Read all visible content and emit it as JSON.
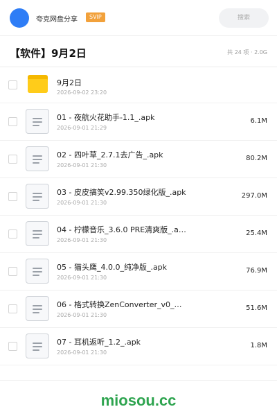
{
  "header": {
    "brand": "夸克网盘分享",
    "badge": "SVIP",
    "search_placeholder": "搜索"
  },
  "folder": {
    "title": "【软件】9月2日",
    "meta": "共 24 项 · 2.0G"
  },
  "items": [
    {
      "type": "folder",
      "name": "9月2日",
      "date": "2026-09-02 23:20",
      "size": ""
    },
    {
      "type": "file",
      "name": "01 - 夜航火花助手-1.1_.apk",
      "date": "2026-09-01 21:29",
      "size": "6.1M"
    },
    {
      "type": "file",
      "name": "02 - 四叶草_2.7.1去广告_.apk",
      "date": "2026-09-01 21:30",
      "size": "80.2M"
    },
    {
      "type": "file",
      "name": "03 - 皮皮搞笑v2.99.350绿化版_.apk",
      "date": "2026-09-01 21:30",
      "size": "297.0M"
    },
    {
      "type": "file",
      "name": "04 - 柠檬音乐_3.6.0 PRE清爽版_.a…",
      "date": "2026-09-01 21:30",
      "size": "25.4M"
    },
    {
      "type": "file",
      "name": "05 - 猫头鹰_4.0.0_纯净版_.apk",
      "date": "2026-09-01 21:30",
      "size": "76.9M"
    },
    {
      "type": "file",
      "name": "06 - 格式转换ZenConverter_v0_…",
      "date": "2026-09-01 21:30",
      "size": "51.6M"
    },
    {
      "type": "file",
      "name": "07 - 耳机返听_1.2_.apk",
      "date": "2026-09-01 21:30",
      "size": "1.8M"
    }
  ],
  "footer": {
    "watermark": "miosou.cc"
  },
  "colors": {
    "avatar": "#2e7df6",
    "badge": "#f2a13b",
    "folder": "#ffcc1a",
    "watermark": "#2ea44f"
  }
}
